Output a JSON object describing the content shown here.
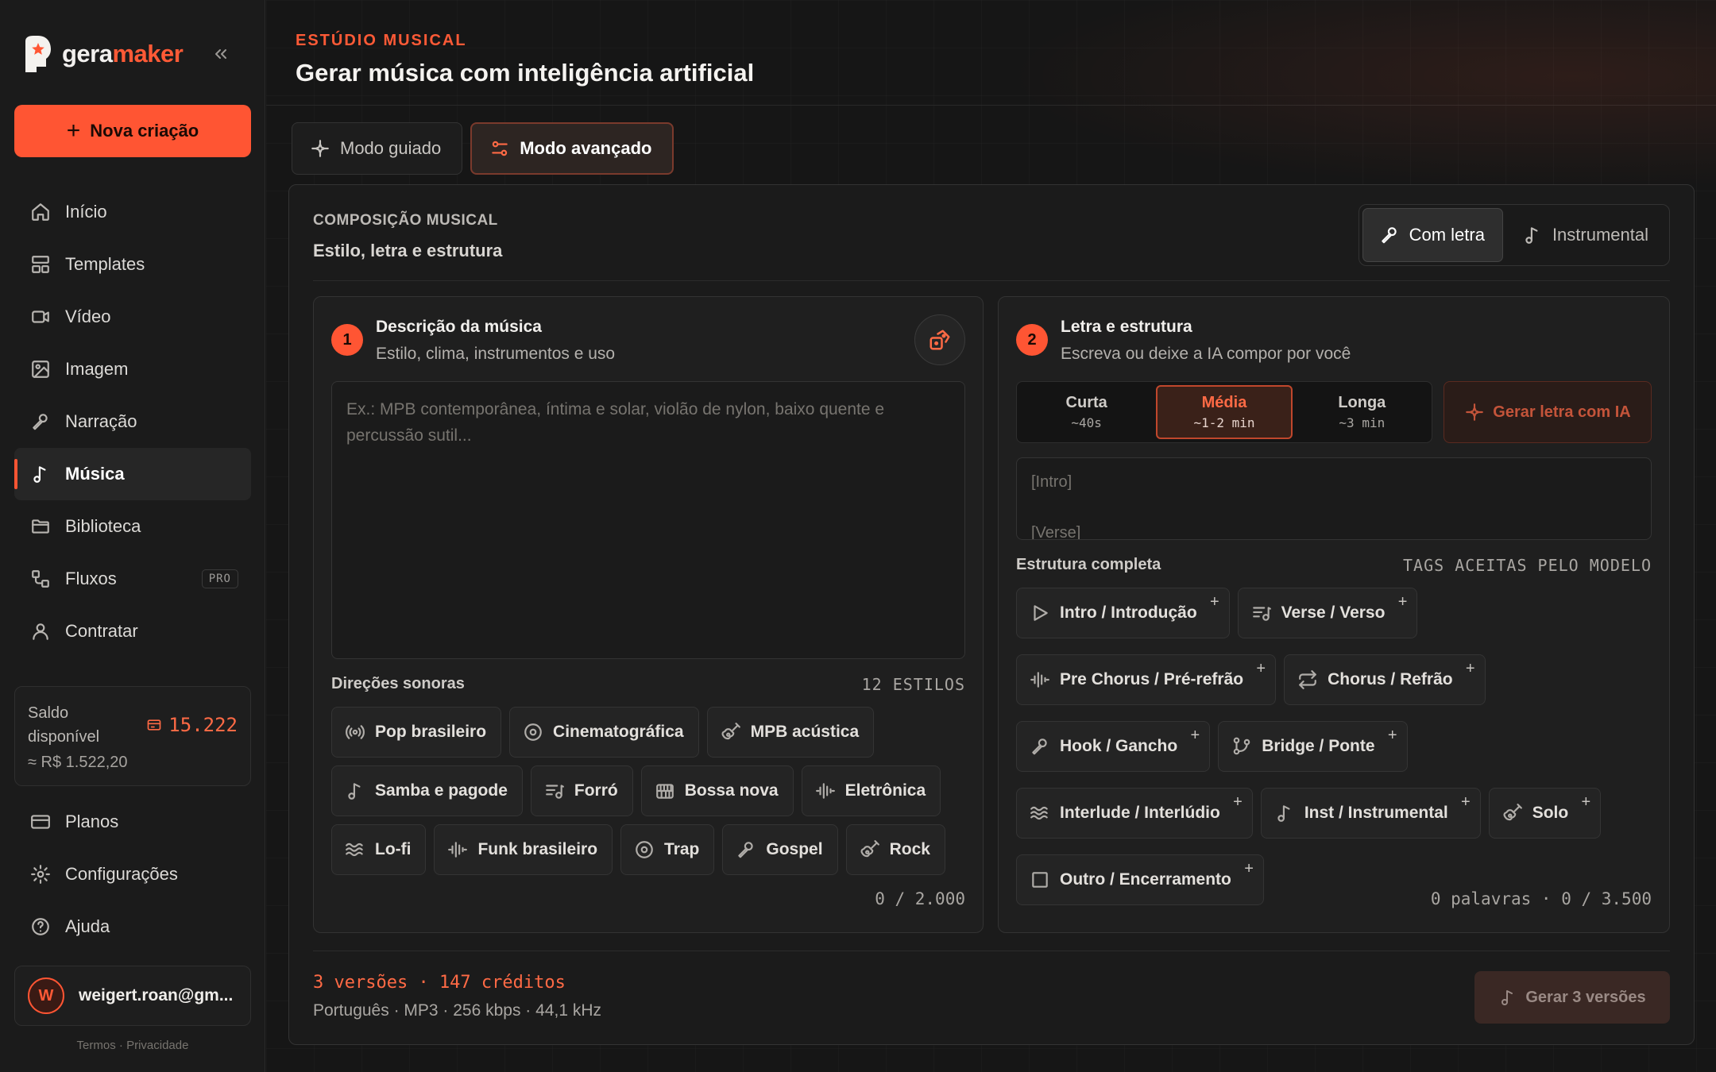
{
  "brand": {
    "name_prefix": "gera",
    "name_accent": "maker"
  },
  "sidebar": {
    "new_button": "Nova criação",
    "items": [
      {
        "label": "Início",
        "icon": "home-icon"
      },
      {
        "label": "Templates",
        "icon": "templates-icon"
      },
      {
        "label": "Vídeo",
        "icon": "video-icon"
      },
      {
        "label": "Imagem",
        "icon": "image-icon"
      },
      {
        "label": "Narração",
        "icon": "microphone-icon"
      },
      {
        "label": "Música",
        "icon": "music-note-icon",
        "active": true
      },
      {
        "label": "Biblioteca",
        "icon": "folder-icon"
      },
      {
        "label": "Fluxos",
        "icon": "flow-icon",
        "badge": "PRO"
      },
      {
        "label": "Contratar",
        "icon": "user-icon"
      }
    ],
    "balance": {
      "label": "Saldo disponível",
      "credits": "15.222",
      "approx": "≈ R$ 1.522,20"
    },
    "bottom_items": [
      {
        "label": "Planos",
        "icon": "card-icon"
      },
      {
        "label": "Configurações",
        "icon": "gear-icon"
      },
      {
        "label": "Ajuda",
        "icon": "help-icon"
      }
    ],
    "user": {
      "initial": "W",
      "email": "weigert.roan@gm..."
    },
    "legal": {
      "terms": "Termos",
      "sep": "·",
      "privacy": "Privacidade"
    }
  },
  "header": {
    "eyebrow": "ESTÚDIO MUSICAL",
    "title": "Gerar música com inteligência artificial"
  },
  "mode_tabs": [
    {
      "label": "Modo guiado",
      "icon": "sparkle-icon"
    },
    {
      "label": "Modo avançado",
      "icon": "sliders-icon",
      "active": true
    }
  ],
  "panel": {
    "eyebrow": "COMPOSIÇÃO MUSICAL",
    "subtitle": "Estilo, letra e estrutura",
    "lyric_toggle": [
      {
        "label": "Com letra",
        "icon": "microphone-icon",
        "active": true
      },
      {
        "label": "Instrumental",
        "icon": "music-note-icon"
      }
    ]
  },
  "description_card": {
    "step": "1",
    "title": "Descrição da música",
    "desc": "Estilo, clima, instrumentos e uso",
    "placeholder": "Ex.: MPB contemporânea, íntima e solar, violão de nylon, baixo quente e percussão sutil...",
    "directions_label": "Direções sonoras",
    "directions_count": "12 ESTILOS",
    "styles": [
      {
        "label": "Pop brasileiro",
        "icon": "broadcast-icon"
      },
      {
        "label": "Cinematográfica",
        "icon": "disc-icon"
      },
      {
        "label": "MPB acústica",
        "icon": "guitar-icon"
      },
      {
        "label": "Samba e pagode",
        "icon": "music-note-icon"
      },
      {
        "label": "Forró",
        "icon": "list-music-icon"
      },
      {
        "label": "Bossa nova",
        "icon": "piano-icon"
      },
      {
        "label": "Eletrônica",
        "icon": "waveform-icon"
      },
      {
        "label": "Lo-fi",
        "icon": "waves-icon"
      },
      {
        "label": "Funk brasileiro",
        "icon": "waveform-icon"
      },
      {
        "label": "Trap",
        "icon": "disc-icon"
      },
      {
        "label": "Gospel",
        "icon": "microphone-icon"
      },
      {
        "label": "Rock",
        "icon": "guitar-icon"
      }
    ],
    "counter": "0 / 2.000"
  },
  "lyrics_card": {
    "step": "2",
    "title": "Letra e estrutura",
    "desc": "Escreva ou deixe a IA compor por você",
    "lengths": [
      {
        "name": "Curta",
        "time": "~40s"
      },
      {
        "name": "Média",
        "time": "~1-2 min",
        "active": true
      },
      {
        "name": "Longa",
        "time": "~3 min"
      }
    ],
    "generate_lyrics": "Gerar letra com IA",
    "lyrics_lines": [
      "[Intro]",
      "[Verse]"
    ],
    "structure_label": "Estrutura completa",
    "structure_meta": "TAGS ACEITAS PELO MODELO",
    "tags": [
      {
        "label": "Intro / Introdução",
        "icon": "play-icon"
      },
      {
        "label": "Verse / Verso",
        "icon": "list-music-icon"
      },
      {
        "label": "Pre Chorus / Pré-refrão",
        "icon": "waveform-icon"
      },
      {
        "label": "Chorus / Refrão",
        "icon": "repeat-icon"
      },
      {
        "label": "Hook / Gancho",
        "icon": "microphone-icon"
      },
      {
        "label": "Bridge / Ponte",
        "icon": "branch-icon"
      },
      {
        "label": "Interlude / Interlúdio",
        "icon": "waves-icon"
      },
      {
        "label": "Inst / Instrumental",
        "icon": "music-note-icon"
      },
      {
        "label": "Solo",
        "icon": "guitar-icon"
      },
      {
        "label": "Outro / Encerramento",
        "icon": "square-icon"
      }
    ],
    "add_symbol": "+",
    "counter": "0 palavras · 0 / 3.500"
  },
  "footer": {
    "versions": "3 versões · 147 créditos",
    "meta": "Português · MP3 · 256 kbps · 44,1 kHz",
    "generate": "Gerar 3 versões"
  },
  "colors": {
    "accent": "#ff5533",
    "background": "#161616",
    "sidebar": "#1b1b1b"
  }
}
